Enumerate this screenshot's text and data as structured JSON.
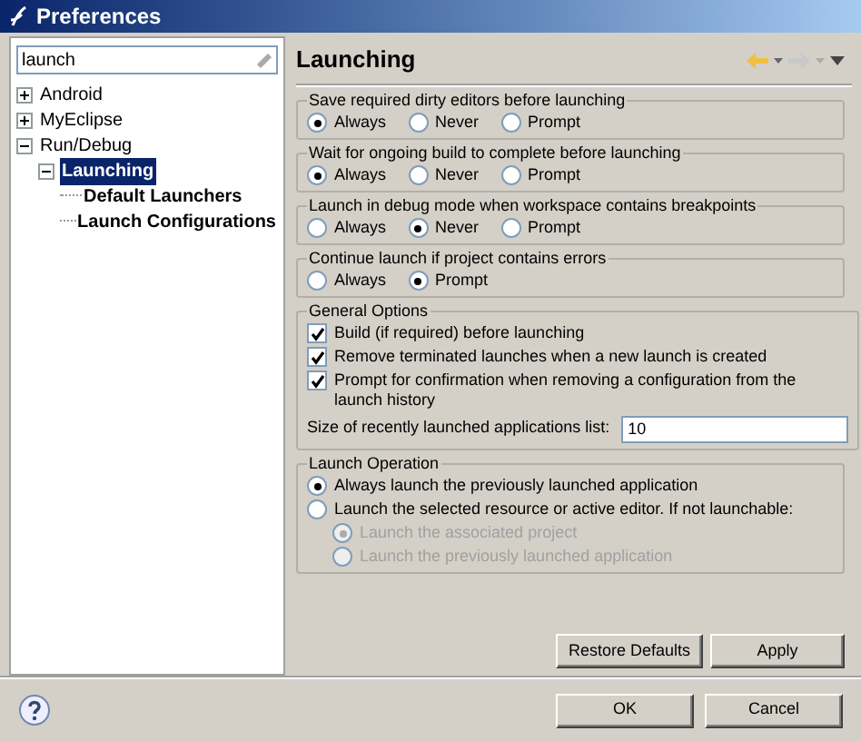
{
  "window": {
    "title": "Preferences"
  },
  "filter": {
    "value": "launch"
  },
  "tree": [
    {
      "label": "Android",
      "expanded": false,
      "matched": false,
      "selected": false
    },
    {
      "label": "MyEclipse",
      "expanded": false,
      "matched": false,
      "selected": false
    },
    {
      "label": "Run/Debug",
      "expanded": true,
      "matched": false,
      "selected": false,
      "children": [
        {
          "label": "Launching",
          "expanded": true,
          "matched": true,
          "selected": true,
          "children": [
            {
              "label": "Default Launchers",
              "matched": true,
              "selected": false
            },
            {
              "label": "Launch Configurations",
              "matched": true,
              "selected": false
            }
          ]
        }
      ]
    }
  ],
  "page": {
    "title": "Launching",
    "groups": [
      {
        "kind": "radio",
        "title": "Save required dirty editors before launching",
        "options": [
          {
            "label": "Always",
            "selected": true
          },
          {
            "label": "Never",
            "selected": false
          },
          {
            "label": "Prompt",
            "selected": false
          }
        ]
      },
      {
        "kind": "radio",
        "title": "Wait for ongoing build to complete before launching",
        "options": [
          {
            "label": "Always",
            "selected": true
          },
          {
            "label": "Never",
            "selected": false
          },
          {
            "label": "Prompt",
            "selected": false
          }
        ]
      },
      {
        "kind": "radio",
        "title": "Launch in debug mode when workspace contains breakpoints",
        "options": [
          {
            "label": "Always",
            "selected": false
          },
          {
            "label": "Never",
            "selected": true
          },
          {
            "label": "Prompt",
            "selected": false
          }
        ]
      },
      {
        "kind": "radio",
        "title": "Continue launch if project contains errors",
        "options": [
          {
            "label": "Always",
            "selected": false
          },
          {
            "label": "Prompt",
            "selected": true
          }
        ]
      },
      {
        "kind": "checks",
        "title": "General Options",
        "checks": [
          {
            "label": "Build (if required) before launching",
            "checked": true
          },
          {
            "label": "Remove terminated launches when a new launch is created",
            "checked": true
          },
          {
            "label": "Prompt for confirmation when removing a configuration from the launch history",
            "checked": true
          }
        ],
        "field": {
          "label": "Size of recently launched applications list:",
          "value": "10"
        }
      },
      {
        "kind": "stack",
        "title": "Launch Operation",
        "options": [
          {
            "label": "Always launch the previously launched application",
            "selected": true,
            "disabled": false
          },
          {
            "label": "Launch the selected resource or active editor. If not launchable:",
            "selected": false,
            "disabled": false,
            "children": [
              {
                "label": "Launch the associated project",
                "selected": true,
                "disabled": true
              },
              {
                "label": "Launch the previously launched application",
                "selected": false,
                "disabled": true
              }
            ]
          }
        ]
      }
    ],
    "buttons": [
      "Restore Defaults",
      "Apply"
    ]
  },
  "dialog_buttons": [
    "OK",
    "Cancel"
  ]
}
